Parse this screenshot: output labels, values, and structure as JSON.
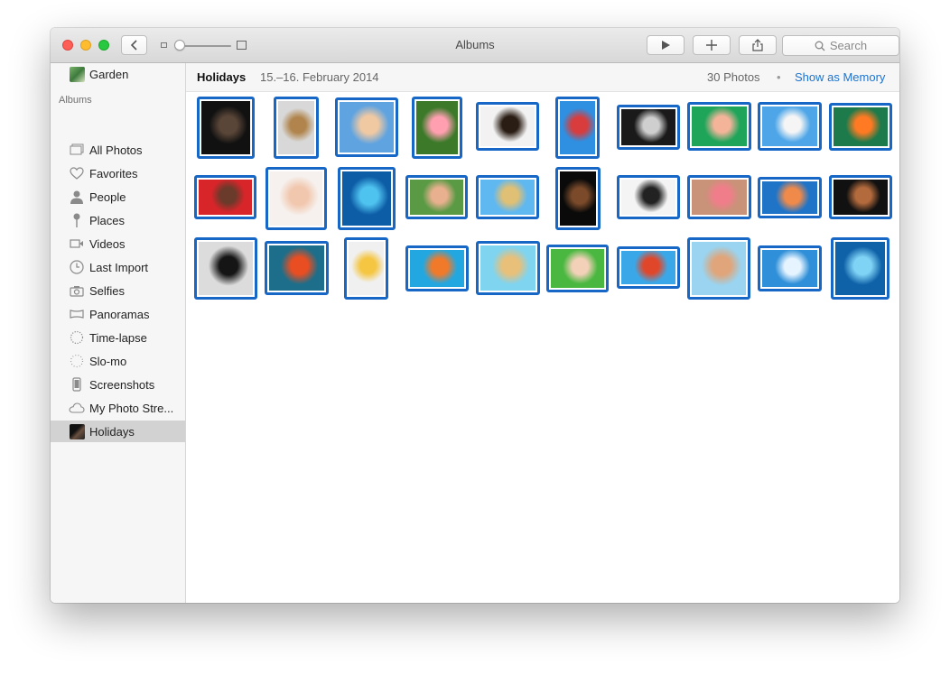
{
  "window": {
    "title": "Albums"
  },
  "toolbar": {
    "search_placeholder": "Search"
  },
  "sidebar": {
    "top_item": {
      "label": "Garden"
    },
    "section_label": "Albums",
    "items": [
      {
        "label": "All Photos",
        "icon": "all-photos-icon"
      },
      {
        "label": "Favorites",
        "icon": "heart-icon"
      },
      {
        "label": "People",
        "icon": "person-icon"
      },
      {
        "label": "Places",
        "icon": "pin-icon"
      },
      {
        "label": "Videos",
        "icon": "video-icon"
      },
      {
        "label": "Last Import",
        "icon": "clock-icon"
      },
      {
        "label": "Selfies",
        "icon": "camera-icon"
      },
      {
        "label": "Panoramas",
        "icon": "panorama-icon"
      },
      {
        "label": "Time-lapse",
        "icon": "timelapse-icon"
      },
      {
        "label": "Slo-mo",
        "icon": "slomo-icon"
      },
      {
        "label": "Screenshots",
        "icon": "phone-icon"
      },
      {
        "label": "My Photo Stre...",
        "icon": "cloud-icon"
      },
      {
        "label": "Holidays",
        "icon": "album-thumbnail",
        "selected": true
      }
    ]
  },
  "album_header": {
    "name": "Holidays",
    "date_range": "15.–16. February 2014",
    "photo_count": "30 Photos",
    "separator": "•",
    "show_as_memory": "Show as Memory"
  },
  "colors": {
    "accent": "#1767c6",
    "link": "#1b74d1",
    "selected_row": "#d2d2d2"
  },
  "photos": [
    {
      "colors": [
        "#111111",
        "#5a4638"
      ]
    },
    {
      "colors": [
        "#d8d8d8",
        "#b0844c"
      ]
    },
    {
      "colors": [
        "#5fa3e0",
        "#f0c9a3"
      ]
    },
    {
      "colors": [
        "#3c7a2a",
        "#ff9fb0"
      ]
    },
    {
      "colors": [
        "#f2f2f2",
        "#2a1d14"
      ]
    },
    {
      "colors": [
        "#2f8fe0",
        "#d83c3c"
      ]
    },
    {
      "colors": [
        "#1a1a1a",
        "#cfcfcf"
      ]
    },
    {
      "colors": [
        "#1fa55a",
        "#f4b49a"
      ]
    },
    {
      "colors": [
        "#4ea6e8",
        "#f5f5f5"
      ]
    },
    {
      "colors": [
        "#1d7a4a",
        "#ff7a22"
      ]
    },
    {
      "colors": [
        "#d8252a",
        "#6a3a2a"
      ]
    },
    {
      "colors": [
        "#f6f1ee",
        "#f1c7ae"
      ]
    },
    {
      "colors": [
        "#0d5da6",
        "#4fc3f0"
      ]
    },
    {
      "colors": [
        "#5a9a45",
        "#e8b08e"
      ]
    },
    {
      "colors": [
        "#60b8f0",
        "#e0c074"
      ]
    },
    {
      "colors": [
        "#0a0a0a",
        "#7a4a2a"
      ]
    },
    {
      "colors": [
        "#f4f4f4",
        "#222222"
      ]
    },
    {
      "colors": [
        "#c89378",
        "#f07e8a"
      ]
    },
    {
      "colors": [
        "#1f74c8",
        "#f08a4a"
      ]
    },
    {
      "colors": [
        "#111111",
        "#b36a3c"
      ]
    },
    {
      "colors": [
        "#dcdcdc",
        "#151515"
      ]
    },
    {
      "colors": [
        "#1c6e8a",
        "#e84e22"
      ]
    },
    {
      "colors": [
        "#f0f0f0",
        "#f5c642"
      ]
    },
    {
      "colors": [
        "#23a7e0",
        "#f07a2a"
      ]
    },
    {
      "colors": [
        "#7fd4f0",
        "#e8c07a"
      ]
    },
    {
      "colors": [
        "#4ab840",
        "#f2d1b8"
      ]
    },
    {
      "colors": [
        "#3aa8e8",
        "#e0472a"
      ]
    },
    {
      "colors": [
        "#9ad4f0",
        "#e0a57a"
      ]
    },
    {
      "colors": [
        "#2f8fd8",
        "#e6f4ff"
      ]
    },
    {
      "colors": [
        "#0f62a8",
        "#7fd3f5"
      ]
    }
  ]
}
